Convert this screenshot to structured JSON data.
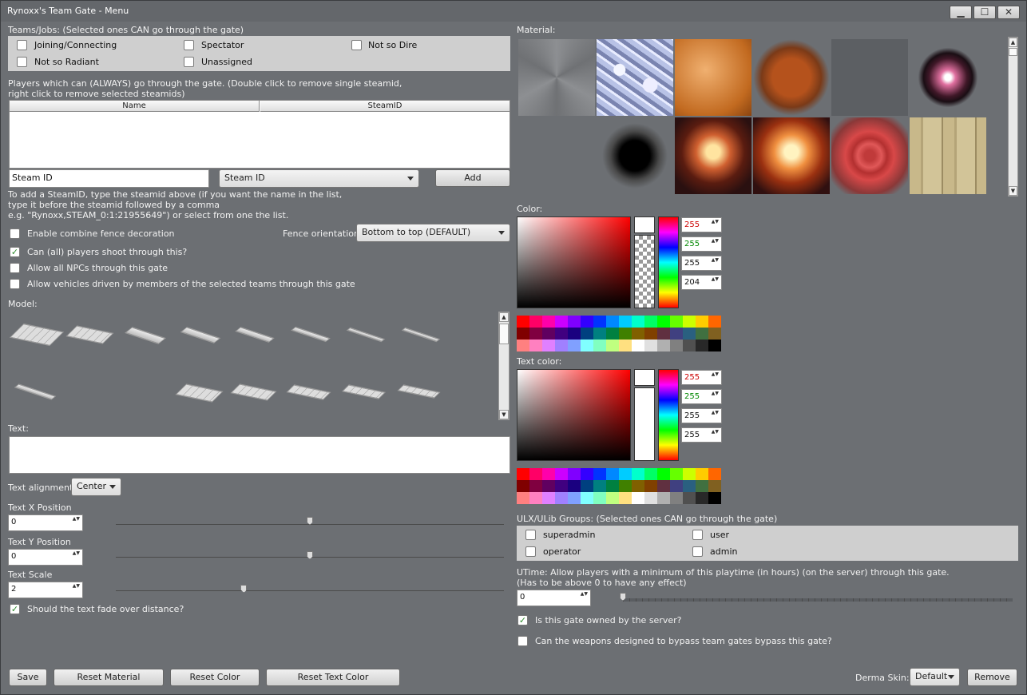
{
  "window": {
    "title": "Rynoxx's Team Gate - Menu",
    "minimize": "▁",
    "maximize": "☐",
    "close": "✕"
  },
  "teams": {
    "header": "Teams/Jobs: (Selected ones CAN go through the gate)",
    "items": [
      {
        "label": "Joining/Connecting",
        "checked": false
      },
      {
        "label": "Spectator",
        "checked": false
      },
      {
        "label": "Not so Dire",
        "checked": false
      },
      {
        "label": "Not so Radiant",
        "checked": false
      },
      {
        "label": "Unassigned",
        "checked": false
      }
    ]
  },
  "players": {
    "header_line1": "Players which can (ALWAYS) go through the gate. (Double click to remove single steamid,",
    "header_line2": "right click to remove selected steamids)",
    "col_name": "Name",
    "col_steamid": "SteamID",
    "input_value": "Steam ID",
    "dropdown_value": "Steam ID",
    "add_label": "Add",
    "help_line1": "To add a SteamID, type the steamid above (if you want the name in the list,",
    "help_line2": "type it before the steamid followed by a comma",
    "help_line3": "e.g. \"Rynoxx,STEAM_0:1:21955649\") or select from one the list."
  },
  "options": {
    "combine_label": "Enable combine fence decoration",
    "fence_orientation_label": "Fence orientation:",
    "fence_orientation_value": "Bottom to top (DEFAULT)",
    "shoot_label": "Can (all) players shoot through this?",
    "npcs_label": "Allow all NPCs through this gate",
    "vehicles_label": "Allow vehicles driven by members of the selected teams through this gate"
  },
  "model": {
    "label": "Model:"
  },
  "text": {
    "label": "Text:",
    "alignment_label": "Text alignment:",
    "alignment_value": "Center",
    "x_label": "Text X Position",
    "x_value": "0",
    "x_slider": 0.5,
    "y_label": "Text Y Position",
    "y_value": "0",
    "y_slider": 0.5,
    "scale_label": "Text Scale",
    "scale_value": "2",
    "scale_slider": 0.33,
    "fade_label": "Should the text fade over distance?"
  },
  "buttons": {
    "save": "Save",
    "reset_material": "Reset Material",
    "reset_color": "Reset Color",
    "reset_text_color": "Reset Text Color",
    "remove": "Remove"
  },
  "material": {
    "label": "Material:"
  },
  "color": {
    "label": "Color:",
    "r": "255",
    "g": "255",
    "b": "255",
    "a": "204"
  },
  "text_color": {
    "label": "Text color:",
    "r": "255",
    "g": "255",
    "b": "255",
    "a": "255"
  },
  "ulx": {
    "header": "ULX/ULib Groups: (Selected ones CAN go through the gate)",
    "items": [
      {
        "label": "superadmin"
      },
      {
        "label": "user"
      },
      {
        "label": "operator"
      },
      {
        "label": "admin"
      }
    ]
  },
  "utime": {
    "line1": "UTime: Allow players with a minimum of this playtime (in hours) (on the server) through this gate.",
    "line2": "(Has to be above 0 to have any effect)",
    "value": "0"
  },
  "owned": {
    "label": "Is this gate owned by the server?"
  },
  "bypass": {
    "label": "Can the weapons designed to bypass team gates bypass this gate?"
  },
  "skin": {
    "label": "Derma Skin:",
    "value": "Default"
  },
  "check_mark": "✓",
  "spin_arrows": "▲▼",
  "palette": [
    "#ff0000",
    "#ff0066",
    "#ff00aa",
    "#cc00ff",
    "#8000ff",
    "#3300ff",
    "#0033ff",
    "#0088ff",
    "#00ccff",
    "#00ffcc",
    "#00ff66",
    "#00ff00",
    "#66ff00",
    "#ccff00",
    "#ffcc00",
    "#ff6600",
    "#800000",
    "#800040",
    "#600060",
    "#400080",
    "#1a0080",
    "#004080",
    "#008080",
    "#008040",
    "#408000",
    "#806000",
    "#804000",
    "#603040",
    "#404080",
    "#2a6080",
    "#407040",
    "#806020",
    "#ff8080",
    "#ff80c0",
    "#e080ff",
    "#a080ff",
    "#80a0ff",
    "#80ffff",
    "#80ffc0",
    "#c0ff80",
    "#ffe080",
    "#ffffff",
    "#e0e0e0",
    "#b0b0b0",
    "#808080",
    "#505050",
    "#282828",
    "#000000"
  ]
}
